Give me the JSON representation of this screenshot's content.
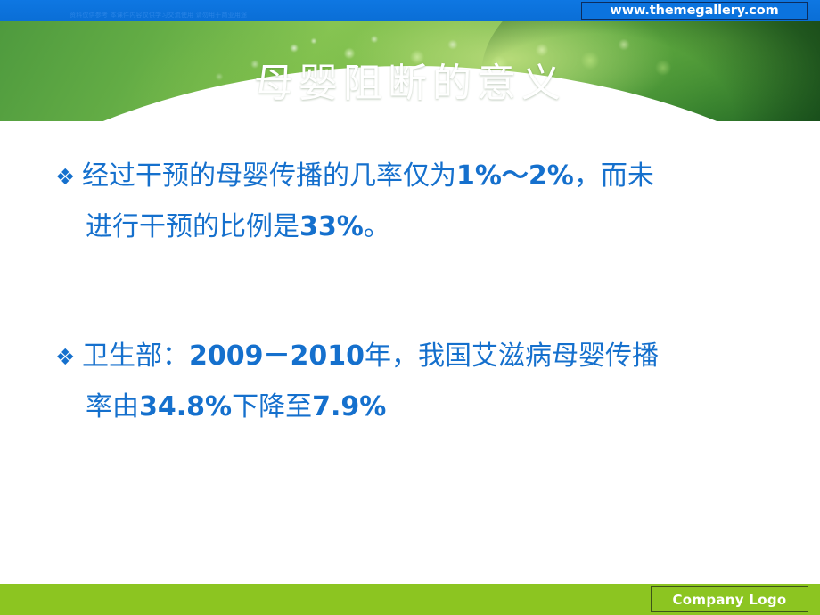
{
  "slide": {
    "title": "母婴阻断的意义",
    "top_bar": {
      "faint_watermark": "资料仅供参考 本课件内容仅供学习交流使用 请勿用于商业用途",
      "url_label": "www.themegallery.com"
    },
    "footer": {
      "logo_label": "Company Logo"
    },
    "content": {
      "bullets": [
        {
          "marker": "❖",
          "lines": [
            [
              {
                "text": "经过干预的母婴传播的几率仅为",
                "bold": false
              },
              {
                "text": "1%～2%",
                "bold": true
              },
              {
                "text": "，而未",
                "bold": false
              }
            ],
            [
              {
                "text": "进行干预的比例是",
                "bold": false
              },
              {
                "text": "33%",
                "bold": true
              },
              {
                "text": "。",
                "bold": false
              }
            ]
          ]
        },
        {
          "marker": "❖",
          "lines": [
            [
              {
                "text": "卫生部：",
                "bold": false
              },
              {
                "text": "2009－2010",
                "bold": true
              },
              {
                "text": "年，我国艾滋病母婴传播",
                "bold": false
              }
            ],
            [
              {
                "text": "率由",
                "bold": false
              },
              {
                "text": "34.8%",
                "bold": true
              },
              {
                "text": "下降至",
                "bold": false
              },
              {
                "text": "7.9%",
                "bold": true
              }
            ]
          ]
        }
      ]
    },
    "colors": {
      "top_bar_blue": "#0b73de",
      "text_blue": "#1570cd",
      "footer_green": "#8cc521",
      "title_white": "#ffffff"
    }
  }
}
